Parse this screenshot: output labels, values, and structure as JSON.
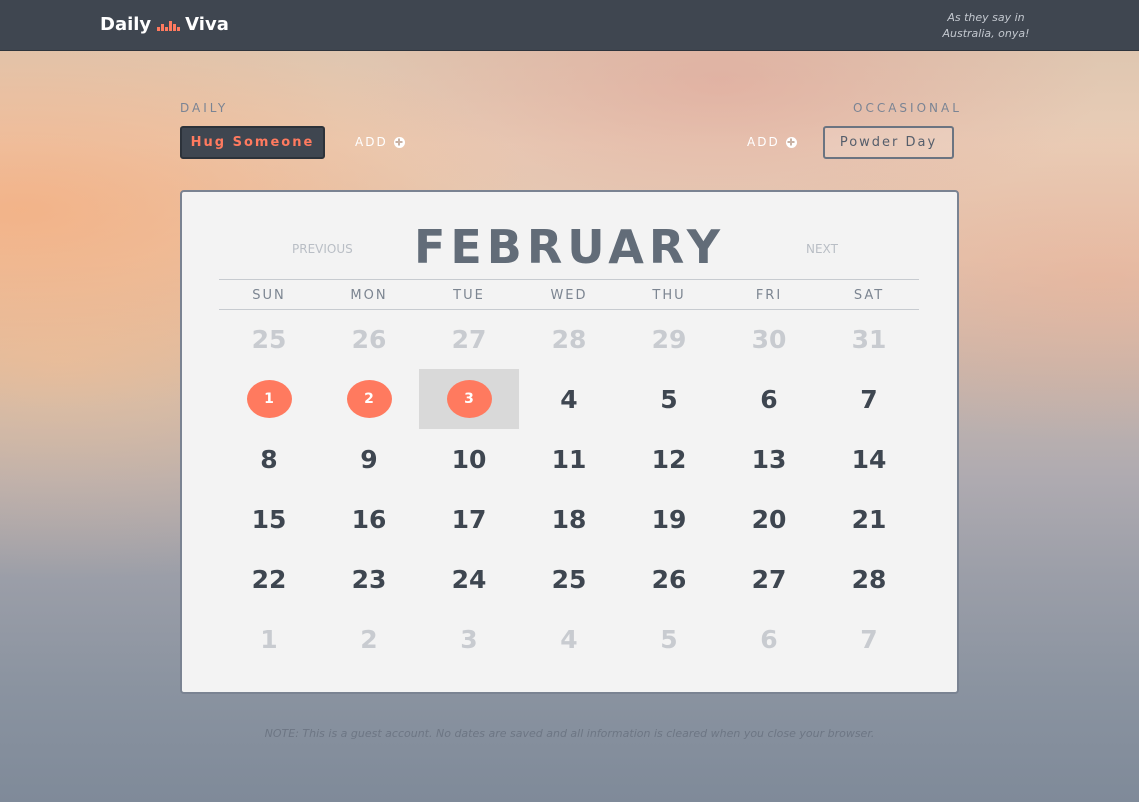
{
  "header": {
    "logo_left": "Daily",
    "logo_right": "Viva",
    "logo_icon": "bar-grid-icon",
    "tagline_line1": "As they say in",
    "tagline_line2": "Australia, onya!"
  },
  "habits": {
    "daily_label": "DAILY",
    "daily_item": "Hug Someone",
    "daily_add": "ADD",
    "occasional_label": "OCCASIONAL",
    "occasional_item": "Powder Day",
    "occasional_add": "ADD"
  },
  "calendar": {
    "prev_label": "PREVIOUS",
    "next_label": "NEXT",
    "month": "FEBRUARY",
    "weekdays": [
      "SUN",
      "MON",
      "TUE",
      "WED",
      "THU",
      "FRI",
      "SAT"
    ],
    "weeks": [
      [
        {
          "d": "25",
          "m": true
        },
        {
          "d": "26",
          "m": true
        },
        {
          "d": "27",
          "m": true
        },
        {
          "d": "28",
          "m": true
        },
        {
          "d": "29",
          "m": true
        },
        {
          "d": "30",
          "m": true
        },
        {
          "d": "31",
          "m": true
        }
      ],
      [
        {
          "d": "1",
          "marked": true
        },
        {
          "d": "2",
          "marked": true
        },
        {
          "d": "3",
          "marked": true,
          "selected": true
        },
        {
          "d": "4"
        },
        {
          "d": "5"
        },
        {
          "d": "6"
        },
        {
          "d": "7"
        }
      ],
      [
        {
          "d": "8"
        },
        {
          "d": "9"
        },
        {
          "d": "10"
        },
        {
          "d": "11"
        },
        {
          "d": "12"
        },
        {
          "d": "13"
        },
        {
          "d": "14"
        }
      ],
      [
        {
          "d": "15"
        },
        {
          "d": "16"
        },
        {
          "d": "17"
        },
        {
          "d": "18"
        },
        {
          "d": "19"
        },
        {
          "d": "20"
        },
        {
          "d": "21"
        }
      ],
      [
        {
          "d": "22"
        },
        {
          "d": "23"
        },
        {
          "d": "24"
        },
        {
          "d": "25"
        },
        {
          "d": "26"
        },
        {
          "d": "27"
        },
        {
          "d": "28"
        }
      ],
      [
        {
          "d": "1",
          "m": true
        },
        {
          "d": "2",
          "m": true
        },
        {
          "d": "3",
          "m": true
        },
        {
          "d": "4",
          "m": true
        },
        {
          "d": "5",
          "m": true
        },
        {
          "d": "6",
          "m": true
        },
        {
          "d": "7",
          "m": true
        }
      ]
    ]
  },
  "footer": {
    "note": "NOTE: This is a guest account. No dates are saved and all information is cleared when you close your browser."
  },
  "colors": {
    "accent": "#ff7a5f",
    "topbar": "#3f4650",
    "calendar_bg": "#f3f3f3"
  }
}
